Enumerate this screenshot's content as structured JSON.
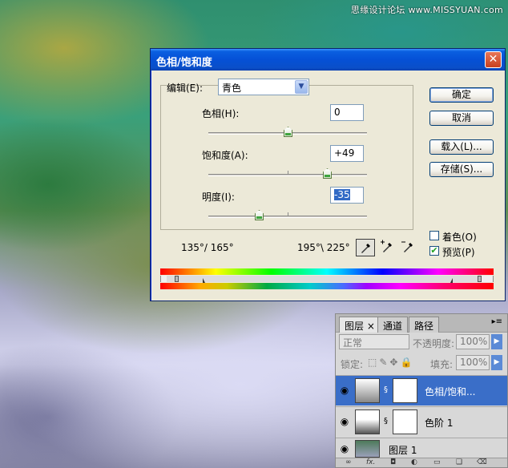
{
  "watermark": "思缘设计论坛 www.MISSYUAN.com",
  "dialog": {
    "title": "色相/饱和度",
    "edit_label": "编辑(E):",
    "edit_value": "青色",
    "hue_label": "色相(H):",
    "hue_value": "0",
    "saturation_label": "饱和度(A):",
    "saturation_value": "+49",
    "lightness_label": "明度(I):",
    "lightness_value": "-35",
    "ok_label": "确定",
    "cancel_label": "取消",
    "load_label": "载入(L)...",
    "save_label": "存储(S)...",
    "colorize_label": "着色(O)",
    "colorize_checked": false,
    "preview_label": "预览(P)",
    "preview_checked": true,
    "range_left": "135°/ 165°",
    "range_right": "195°\\ 225°",
    "close_symbol": "✕"
  },
  "layers_panel": {
    "tabs": [
      "图层",
      "通道",
      "路径"
    ],
    "tab_close": "×",
    "blend_mode": "正常",
    "opacity_label": "不透明度:",
    "opacity_value": "100%",
    "lock_label": "锁定:",
    "fill_label": "填充:",
    "fill_value": "100%",
    "layers": [
      {
        "name": "色相/饱和...",
        "selected": true
      },
      {
        "name": "色阶 1",
        "selected": false
      },
      {
        "name": "图层 1",
        "selected": false
      }
    ],
    "footer_icons": [
      "link-icon",
      "fx-icon",
      "mask-icon",
      "adjustment-icon",
      "folder-icon",
      "new-layer-icon",
      "trash-icon"
    ],
    "footer_fx": "fx."
  }
}
